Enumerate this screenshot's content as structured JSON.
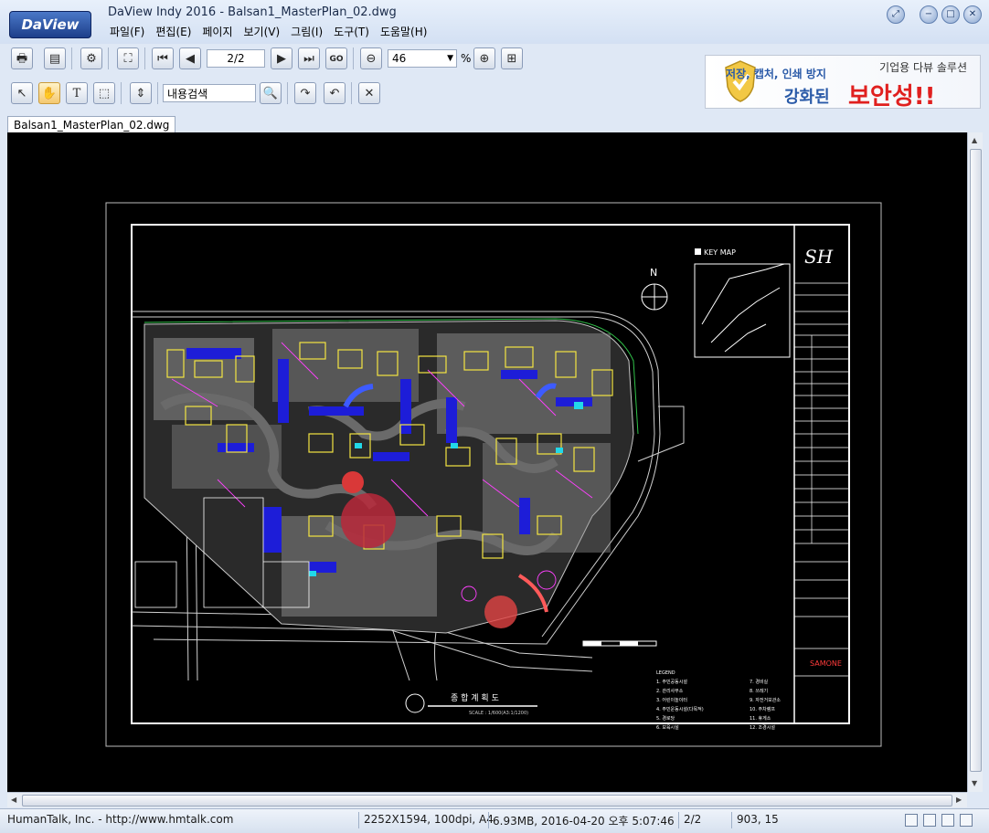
{
  "app": {
    "logo": "DaView",
    "title": "DaView Indy 2016 - Balsan1_MasterPlan_02.dwg"
  },
  "menu": [
    "파일(F)",
    "편집(E)",
    "페이지",
    "보기(V)",
    "그림(I)",
    "도구(T)",
    "도움말(H)"
  ],
  "toolbar": {
    "page_value": "2/2",
    "go_label": "GO",
    "zoom_value": "46",
    "zoom_unit": "%",
    "search_value": "내용검색"
  },
  "banner": {
    "line1": "저장, 캡처, 인쇄 방지",
    "line2": "기업용 다뷰 솔루션",
    "line3": "강화된",
    "line4": "보안성!!"
  },
  "tab": {
    "label": "Balsan1_MasterPlan_02.dwg"
  },
  "drawing": {
    "north_label": "N",
    "keymap_label": "KEY MAP",
    "title_text": "종 합 계 획 도",
    "scale_text": "SCALE : 1/600(A3:1/1200)",
    "legend_title": "LEGEND",
    "legend_left": [
      "1. 주민공동시설",
      "2. 관리사무소",
      "3. 어린이놀이터",
      "4. 주민운동시설(다목적)",
      "5. 경로당",
      "6. 보육시설"
    ],
    "legend_right": [
      "7. 경비실",
      "8. 쓰레기",
      "9. 자전거보관소",
      "10. 주차램프",
      "11. 휴게소",
      "12. 조경시설"
    ],
    "logo_text": "SH",
    "brand_text": "SAMONE",
    "accent_red": "#ff2a2a",
    "accent_green": "#31c24a"
  },
  "status": {
    "company": "HumanTalk, Inc. - http://www.hmtalk.com",
    "dimensions": "2252X1594, 100dpi, A4",
    "fileinfo": "6.93MB, 2016-04-20 오후 5:07:46",
    "page": "2/2",
    "coords": "903, 15"
  }
}
